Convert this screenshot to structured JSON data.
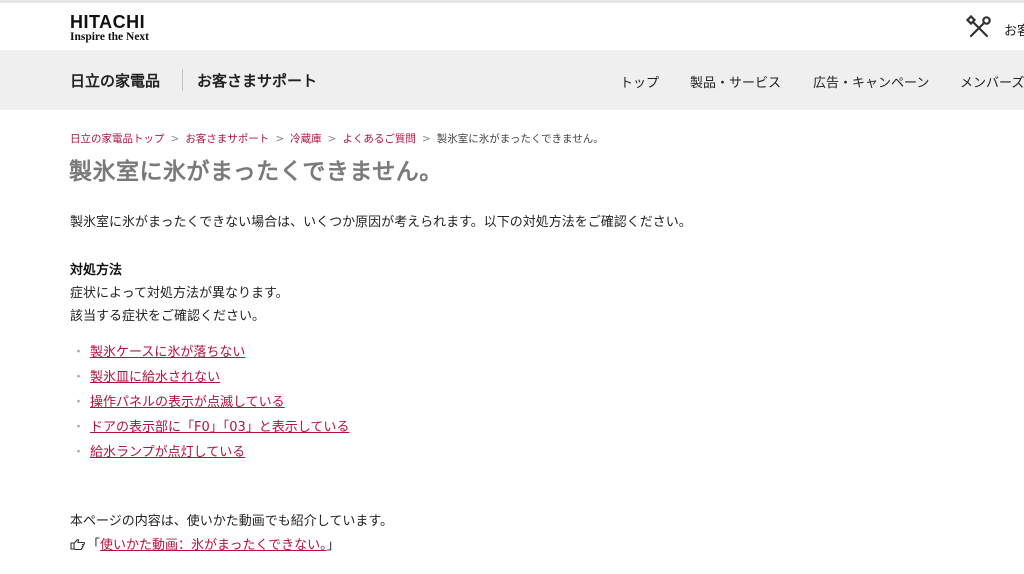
{
  "header": {
    "logo_main": "HITACHI",
    "logo_sub": "Inspire the Next",
    "support_link": "お客",
    "tool_icon": "tools-icon"
  },
  "nav": {
    "brand": "日立の家電品",
    "support": "お客さまサポート",
    "items": [
      "トップ",
      "製品・サービス",
      "広告・キャンペーン",
      "メンバーズ"
    ]
  },
  "breadcrumb": {
    "items": [
      "日立の家電品トップ",
      "お客さまサポート",
      "冷蔵庫",
      "よくあるご質問"
    ],
    "separator": ">",
    "current": "製氷室に氷がまったくできません。"
  },
  "page": {
    "title": "製氷室に氷がまったくできません。",
    "intro": "製氷室に氷がまったくできない場合は、いくつか原因が考えられます。以下の対処方法をご確認ください。",
    "method_heading": "対処方法",
    "method_p1": "症状によって対処方法が異なります。",
    "method_p2": "該当する症状をご確認ください。",
    "bullet": "・",
    "links": [
      "製氷ケースに氷が落ちない",
      "製氷皿に給水されない",
      "操作パネルの表示が点滅している",
      "ドアの表示部に「F0」「03」と表示している",
      "給水ランプが点灯している"
    ],
    "video_intro": "本ページの内容は、使いかた動画でも紹介しています。",
    "video_open": "「",
    "video_link": "使いかた動画：氷がまったくできない。",
    "video_close": "」",
    "video_icon": "pointing-hand-icon"
  },
  "colors": {
    "link": "#b5123e",
    "nav_bg": "#efefef",
    "title": "#7a7a7a"
  }
}
